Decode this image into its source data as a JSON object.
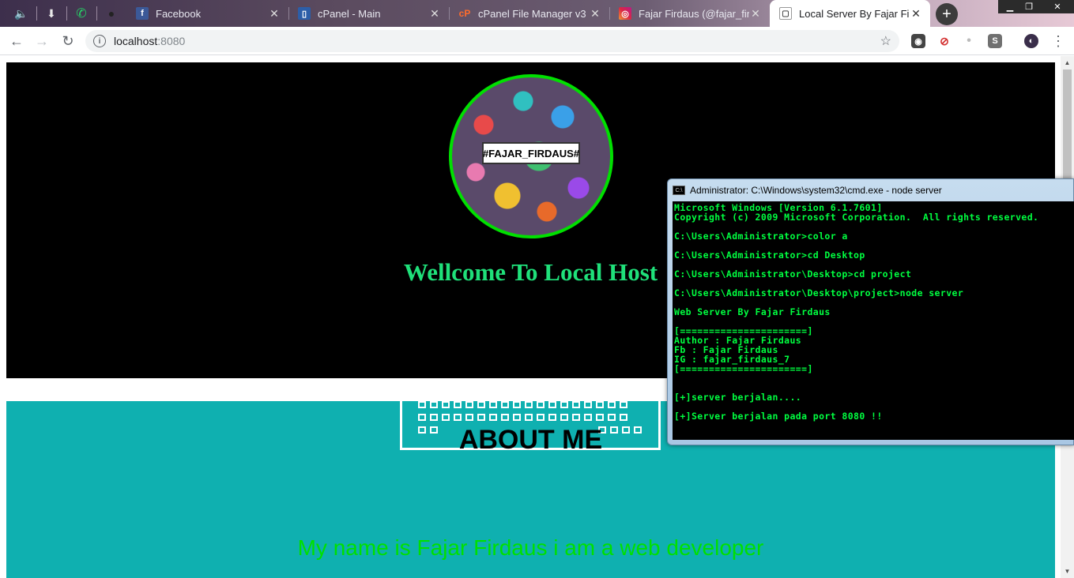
{
  "browser": {
    "pinned_tabs": [
      {
        "name": "audio-icon",
        "glyph": "🔈"
      },
      {
        "name": "download-icon",
        "glyph": "⬇"
      },
      {
        "name": "whatsapp-icon",
        "glyph": "✆"
      },
      {
        "name": "github-icon",
        "glyph": "●"
      }
    ],
    "tabs": [
      {
        "title": "Facebook",
        "favicon": "f",
        "favicon_color": "#3b5998",
        "close": "✕"
      },
      {
        "title": "cPanel - Main",
        "favicon": "▯",
        "favicon_color": "#2c5ea8",
        "close": "✕"
      },
      {
        "title": "cPanel File Manager v3",
        "favicon": "cP",
        "favicon_color": "#ff6c2c",
        "close": "✕"
      },
      {
        "title": "Fajar Firdaus (@fajar_firda",
        "favicon": "◎",
        "favicon_color": "#d6249f",
        "close": "✕"
      },
      {
        "title": "Local Server By Fajar Firda",
        "favicon": "▢",
        "favicon_color": "#ffffff",
        "close": "✕"
      }
    ],
    "new_tab": "+",
    "window_controls": {
      "minimize": "▁",
      "restore": "❐",
      "close": "✕"
    },
    "nav": {
      "back": "←",
      "forward": "→",
      "reload": "↻"
    },
    "address": {
      "info": "i",
      "host": "localhost",
      "port": ":8080",
      "bookmark": "☆"
    },
    "extensions": [
      {
        "name": "extension-camera-icon",
        "glyph": "◉",
        "color": "#444444"
      },
      {
        "name": "extension-block-icon",
        "glyph": "⊘",
        "color": "#d32f2f"
      },
      {
        "name": "extension-dot-icon",
        "glyph": "•",
        "color": "#bbbbbb"
      },
      {
        "name": "extension-s-icon",
        "glyph": "S",
        "color": "#707070"
      },
      {
        "name": "profile-avatar-icon",
        "glyph": "◐",
        "color": "#3a2e4a"
      }
    ],
    "menu": "⋮"
  },
  "page": {
    "avatar_tag": "#FAJAR_FIRDAUS#",
    "welcome": "Wellcome To Local Host",
    "about_title": "ABOUT ME",
    "about_text": "My name is Fajar Firdaus i am a web developer"
  },
  "cmd": {
    "title": "Administrator: C:\\Windows\\system32\\cmd.exe - node  server",
    "icon": "C:\\",
    "lines": [
      "Microsoft Windows [Version 6.1.7601]",
      "Copyright (c) 2009 Microsoft Corporation.  All rights reserved.",
      "",
      "C:\\Users\\Administrator>color a",
      "",
      "C:\\Users\\Administrator>cd Desktop",
      "",
      "C:\\Users\\Administrator\\Desktop>cd project",
      "",
      "C:\\Users\\Administrator\\Desktop\\project>node server",
      "",
      "Web Server By Fajar Firdaus",
      "",
      "[======================]",
      "Author : Fajar Firdaus",
      "Fb : Fajar Firdaus",
      "IG : fajar_firdaus_7",
      "[======================]",
      "",
      "",
      "[+]server berjalan....",
      "",
      "[+]Server berjalan pada port 8080 !!"
    ]
  },
  "colors": {
    "hero_bg": "#000000",
    "welcome": "#1fe07a",
    "avatar_ring": "#00e000",
    "about_bg": "#0fb0b0",
    "about_text": "#00e000",
    "console_text": "#00ff40"
  }
}
